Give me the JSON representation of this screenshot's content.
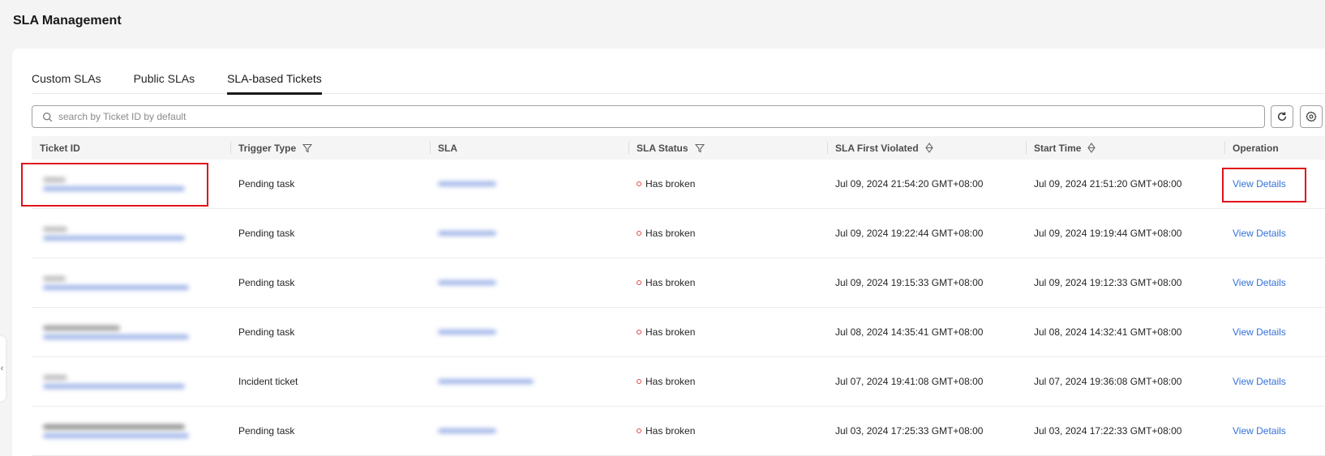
{
  "page": {
    "title": "SLA Management"
  },
  "tabs": [
    {
      "label": "Custom SLAs",
      "active": false
    },
    {
      "label": "Public SLAs",
      "active": false
    },
    {
      "label": "SLA-based Tickets",
      "active": true
    }
  ],
  "search": {
    "placeholder": "search by Ticket ID by default",
    "value": ""
  },
  "toolbar": {
    "refresh_icon": "refresh-icon",
    "settings_icon": "gear-icon"
  },
  "table": {
    "columns": [
      {
        "label": "Ticket ID",
        "icon": null
      },
      {
        "label": "Trigger Type",
        "icon": "filter-icon"
      },
      {
        "label": "SLA",
        "icon": null
      },
      {
        "label": "SLA Status",
        "icon": "filter-icon"
      },
      {
        "label": "SLA First Violated",
        "icon": "sort-icon"
      },
      {
        "label": "Start Time",
        "icon": "sort-icon"
      },
      {
        "label": "Operation",
        "icon": null
      }
    ],
    "rows": [
      {
        "trigger_type": "Pending task",
        "status": "Has broken",
        "first_violated": "Jul 09, 2024 21:54:20 GMT+08:00",
        "start_time": "Jul 09, 2024 21:51:20 GMT+08:00",
        "operation": "View Details"
      },
      {
        "trigger_type": "Pending task",
        "status": "Has broken",
        "first_violated": "Jul 09, 2024 19:22:44 GMT+08:00",
        "start_time": "Jul 09, 2024 19:19:44 GMT+08:00",
        "operation": "View Details"
      },
      {
        "trigger_type": "Pending task",
        "status": "Has broken",
        "first_violated": "Jul 09, 2024 19:15:33 GMT+08:00",
        "start_time": "Jul 09, 2024 19:12:33 GMT+08:00",
        "operation": "View Details"
      },
      {
        "trigger_type": "Pending task",
        "status": "Has broken",
        "first_violated": "Jul 08, 2024 14:35:41 GMT+08:00",
        "start_time": "Jul 08, 2024 14:32:41 GMT+08:00",
        "operation": "View Details"
      },
      {
        "trigger_type": "Incident ticket",
        "status": "Has broken",
        "first_violated": "Jul 07, 2024 19:41:08 GMT+08:00",
        "start_time": "Jul 07, 2024 19:36:08 GMT+08:00",
        "operation": "View Details"
      },
      {
        "trigger_type": "Pending task",
        "status": "Has broken",
        "first_violated": "Jul 03, 2024 17:25:33 GMT+08:00",
        "start_time": "Jul 03, 2024 17:22:33 GMT+08:00",
        "operation": "View Details"
      }
    ]
  },
  "colors": {
    "link": "#3271d9",
    "status_broken": "#e54545",
    "highlight": "#e0101a",
    "tab_active": "#191919"
  },
  "collapse_handle": {
    "glyph": "‹"
  }
}
